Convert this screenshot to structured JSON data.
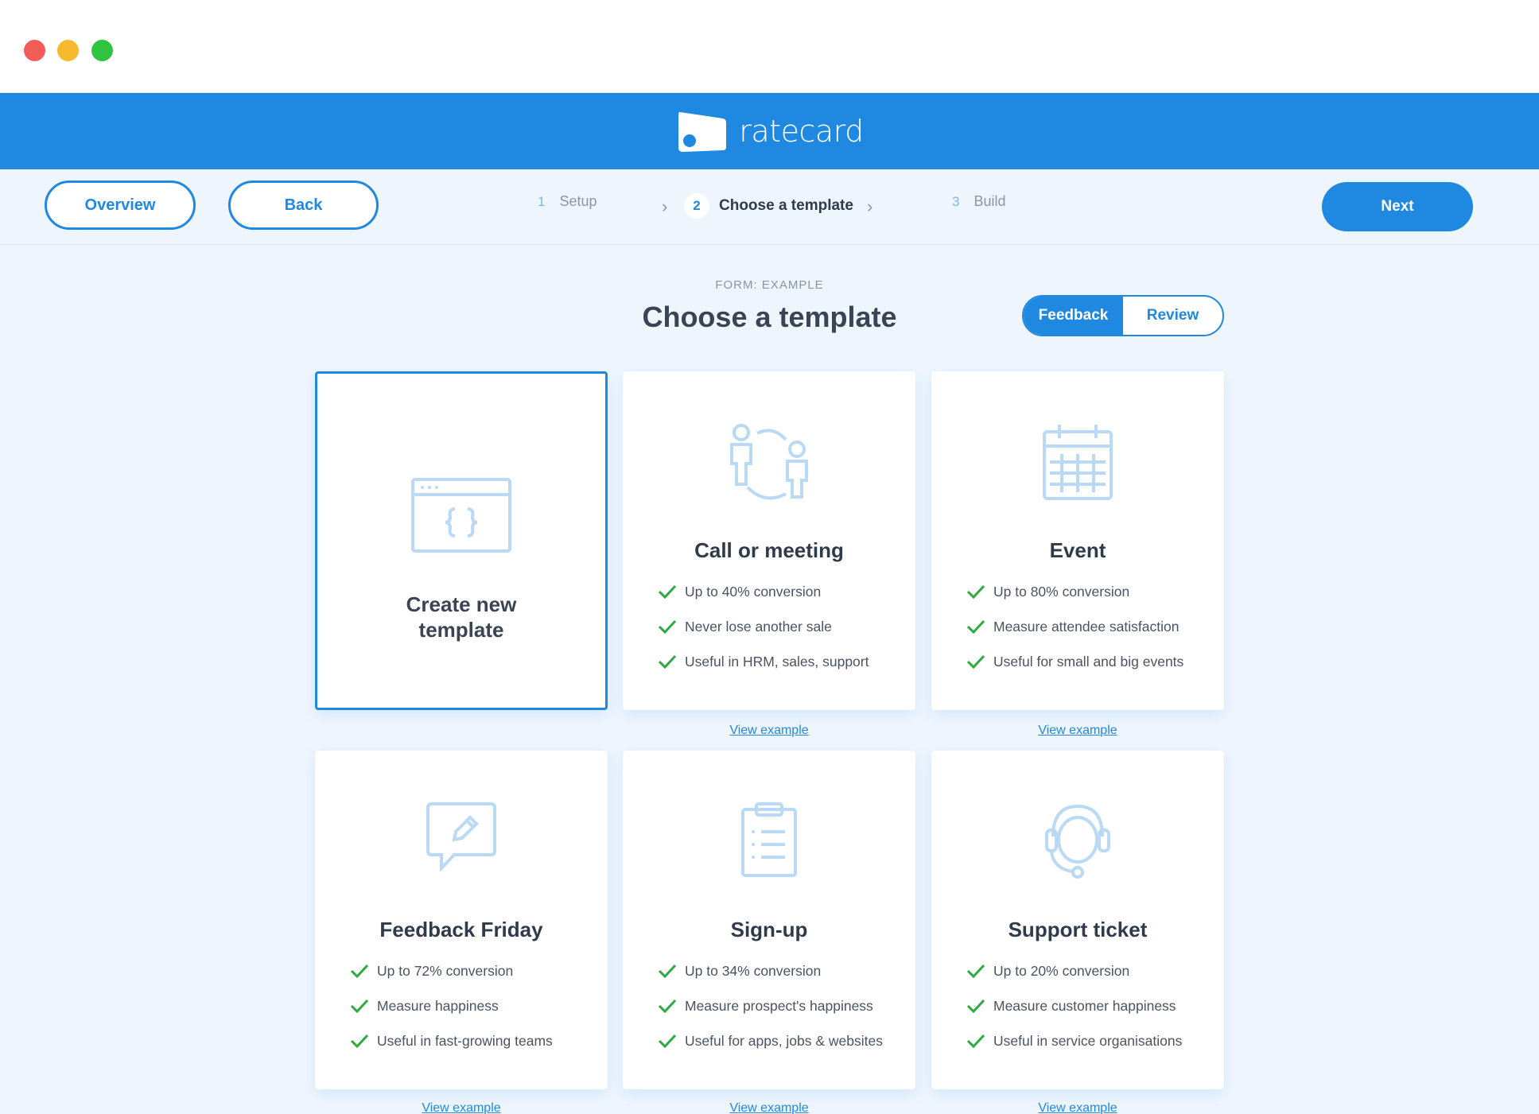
{
  "brand": {
    "name": "ratecard"
  },
  "nav": {
    "overview_label": "Overview",
    "back_label": "Back",
    "next_label": "Next"
  },
  "steps": [
    {
      "number": "1",
      "label": "Setup"
    },
    {
      "number": "2",
      "label": "Choose a template"
    },
    {
      "number": "3",
      "label": "Build"
    }
  ],
  "header": {
    "eyebrow": "FORM: EXAMPLE",
    "title": "Choose a template"
  },
  "toggle": {
    "feedback_label": "Feedback",
    "review_label": "Review",
    "selected": "Feedback"
  },
  "create_card": {
    "line1": "Create new",
    "line2": "template",
    "icon": "code-window-icon"
  },
  "templates": [
    {
      "title": "Call or meeting",
      "icon": "people-exchange-icon",
      "features": [
        "Up to 40% conversion",
        "Never lose another sale",
        "Useful in HRM, sales, support"
      ],
      "link": "View example"
    },
    {
      "title": "Event",
      "icon": "calendar-icon",
      "features": [
        "Up to 80% conversion",
        "Measure attendee satisfaction",
        "Useful for small and big events"
      ],
      "link": "View example"
    },
    {
      "title": "Feedback Friday",
      "icon": "chat-edit-icon",
      "features": [
        "Up to 72% conversion",
        "Measure happiness",
        "Useful in fast-growing teams"
      ],
      "link": "View example"
    },
    {
      "title": "Sign-up",
      "icon": "clipboard-icon",
      "features": [
        "Up to 34% conversion",
        "Measure prospect's happiness",
        "Useful for apps, jobs & websites"
      ],
      "link": "View example"
    },
    {
      "title": "Support ticket",
      "icon": "headset-icon",
      "features": [
        "Up to 20% conversion",
        "Measure customer happiness",
        "Useful in service organisations"
      ],
      "link": "View example"
    }
  ],
  "colors": {
    "accent": "#1f88e0",
    "check": "#2eaa3f",
    "icon_light": "#b9d9f5"
  }
}
